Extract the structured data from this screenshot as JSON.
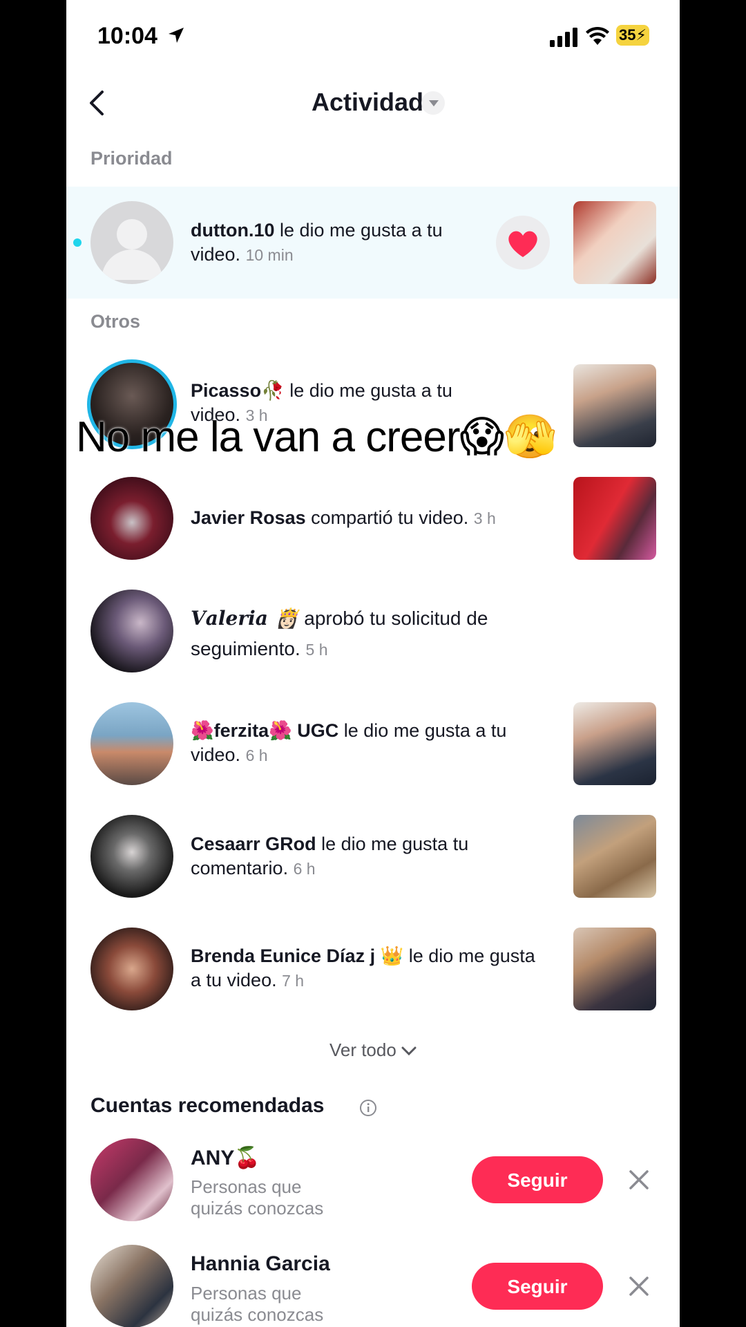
{
  "status_bar": {
    "time": "10:04",
    "battery": "35"
  },
  "header": {
    "title": "Actividad"
  },
  "sections": {
    "priority": "Prioridad",
    "others": "Otros"
  },
  "priority_item": {
    "user": "dutton.10",
    "text": " le dio me gusta a tu video.",
    "time": "10 min"
  },
  "overlay_caption": "No me la van a creer😱🫣",
  "activity": [
    {
      "user": "Picasso🥀",
      "text": " le dio me gusta a tu video.",
      "time": "3 h"
    },
    {
      "user": "Javier Rosas",
      "text": " compartió tu video.",
      "time": "3 h"
    },
    {
      "user": "𝑽𝒂𝒍𝒆𝒓𝒊𝒂 👸🏻",
      "text": " aprobó tu solicitud de seguimiento.",
      "time": "5 h"
    },
    {
      "user": "🌺ferzita🌺 UGC",
      "text": " le dio me gusta a tu video.",
      "time": "6 h"
    },
    {
      "user": "Cesaarr GRod",
      "text": " le dio me gusta tu comentario.",
      "time": "6 h"
    },
    {
      "user": "Brenda Eunice Díaz j 👑",
      "text": " le dio me gusta a tu video.",
      "time": "7 h"
    }
  ],
  "see_all": "Ver todo",
  "recommended": {
    "title": "Cuentas recomendadas",
    "accounts": [
      {
        "name": "ANY🍒",
        "subtitle": "Personas que quizás conozcas",
        "button": "Seguir"
      },
      {
        "name": "Hannia Garcia",
        "subtitle": "Personas que quizás conozcas",
        "button": "Seguir"
      }
    ]
  },
  "colors": {
    "accent": "#fe2c55",
    "unread_dot": "#20d5ec",
    "highlight_bg": "#f1fafd"
  }
}
